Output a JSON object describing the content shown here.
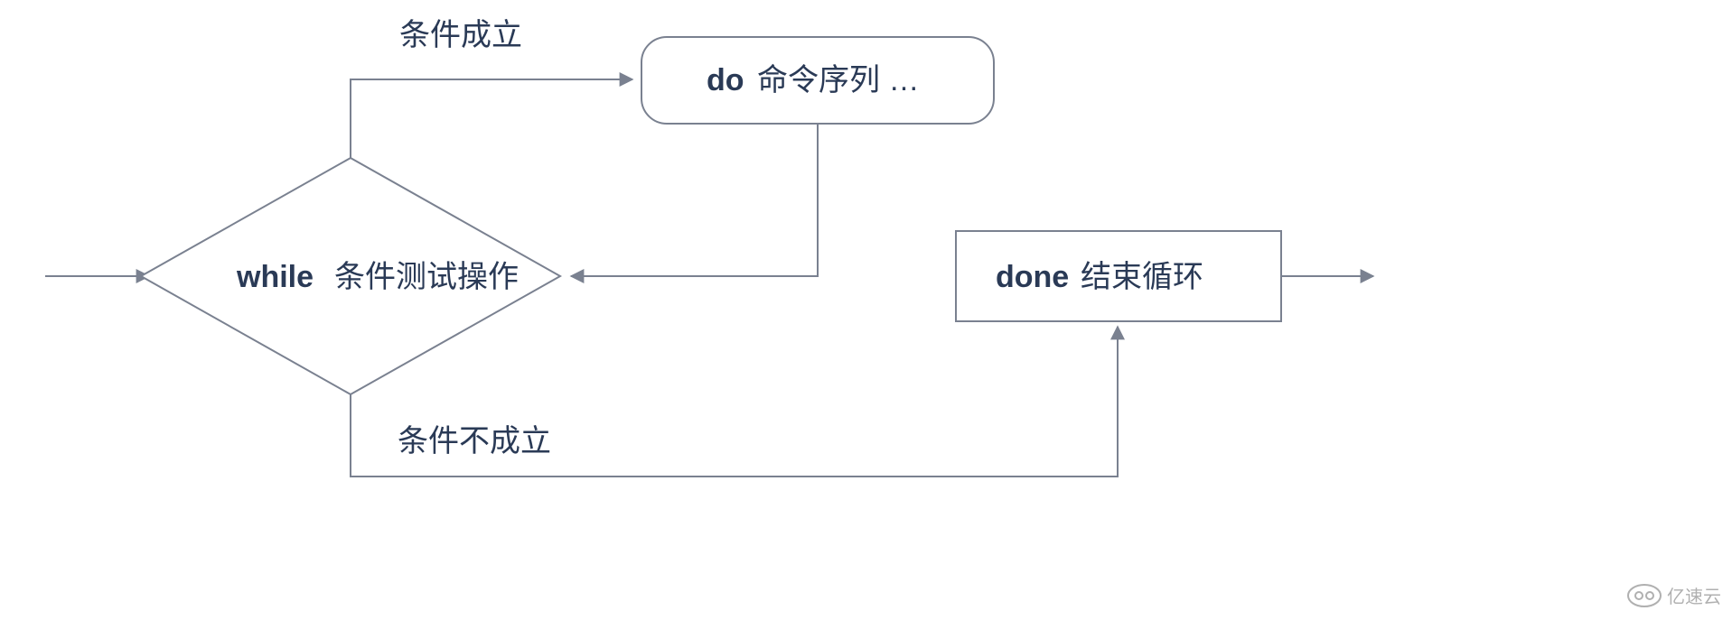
{
  "type": "flowchart",
  "title": "while loop flowchart",
  "nodes": {
    "condition": {
      "keyword": "while",
      "label": "条件测试操作"
    },
    "body": {
      "keyword": "do",
      "label": "命令序列 …"
    },
    "end": {
      "keyword": "done",
      "label": "结束循环"
    }
  },
  "edges": {
    "true_label": "条件成立",
    "false_label": "条件不成立"
  },
  "watermark": "亿速云"
}
